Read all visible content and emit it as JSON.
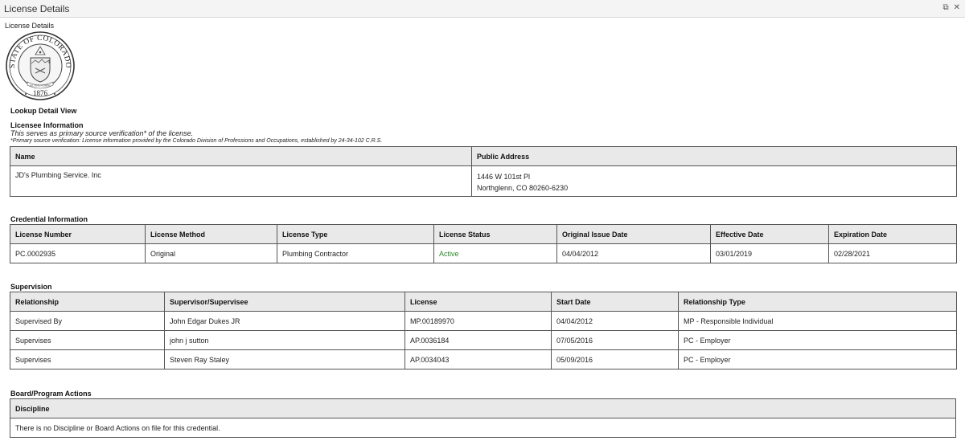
{
  "window": {
    "title": "License Details",
    "restore_glyph": "⧉",
    "close_glyph": "✕"
  },
  "page": {
    "subtitle": "License Details"
  },
  "seal": {
    "top_text": "STATE OF COLORADO",
    "motto": "NIL SINE NUMINE",
    "year": "1876"
  },
  "lookup_title": "Lookup Detail View",
  "licensee": {
    "section_title": "Licensee Information",
    "note": "This serves as primary source verification* of the license.",
    "footnote": "*Primary source verification: License information provided by the Colorado Division of Professions and Occupations, established by 24-34-102 C.R.S.",
    "headers": {
      "name": "Name",
      "address": "Public Address"
    },
    "name": "JD's Plumbing Service. Inc",
    "address_line1": "1446 W 101st Pl",
    "address_line2": "Northglenn, CO 80260-6230"
  },
  "credential": {
    "section_title": "Credential Information",
    "headers": [
      "License Number",
      "License Method",
      "License Type",
      "License Status",
      "Original Issue Date",
      "Effective Date",
      "Expiration Date"
    ],
    "row": [
      "PC.0002935",
      "Original",
      "Plumbing Contractor",
      "Active",
      "04/04/2012",
      "03/01/2019",
      "02/28/2021"
    ],
    "status_color": "#2e8b2e"
  },
  "supervision": {
    "section_title": "Supervision",
    "headers": [
      "Relationship",
      "Supervisor/Supervisee",
      "License",
      "Start Date",
      "Relationship Type"
    ],
    "rows": [
      [
        "Supervised By",
        "John Edgar Dukes JR",
        "MP.00189970",
        "04/04/2012",
        "MP - Responsible Individual"
      ],
      [
        "Supervises",
        "john j sutton",
        "AP.0036184",
        "07/05/2016",
        "PC - Employer"
      ],
      [
        "Supervises",
        "Steven Ray Staley",
        "AP.0034043",
        "05/09/2016",
        "PC - Employer"
      ]
    ]
  },
  "board": {
    "section_title": "Board/Program Actions",
    "header": "Discipline",
    "message": "There is no Discipline or Board Actions on file for this credential."
  }
}
